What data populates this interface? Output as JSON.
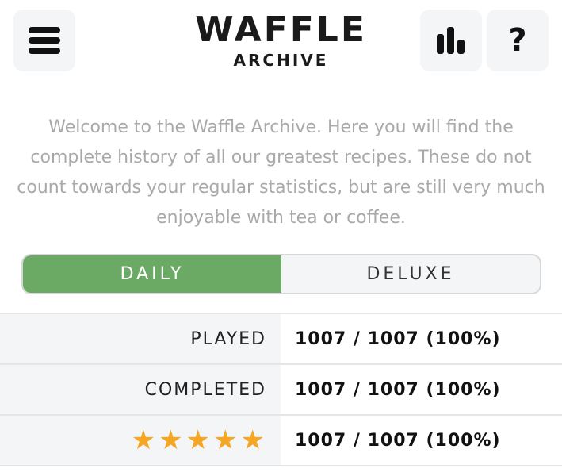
{
  "header": {
    "title": "WAFFLE",
    "subtitle": "ARCHIVE",
    "menu_icon": "hamburger-menu-icon",
    "stats_icon": "bar-chart-icon",
    "help_icon": "question-mark-icon",
    "help_glyph": "?"
  },
  "intro": {
    "text": "Welcome to the Waffle Archive. Here you will find the complete history of all our greatest recipes. These do not count towards your regular statistics, but are still very much enjoyable with tea or coffee."
  },
  "tabs": [
    {
      "label": "DAILY",
      "active": true
    },
    {
      "label": "DELUXE",
      "active": false
    }
  ],
  "stats": {
    "played_label": "PLAYED",
    "played_value": "1007 / 1007 (100%)",
    "completed_label": "COMPLETED",
    "completed_value": "1007 / 1007 (100%)",
    "five_star_rating": 5,
    "five_star_value": "1007 / 1007 (100%)"
  },
  "colors": {
    "accent_green": "#6aaa64",
    "star_gold": "#f5a623",
    "text_muted": "#a9a9a9",
    "panel_gray": "#f4f5f7"
  }
}
